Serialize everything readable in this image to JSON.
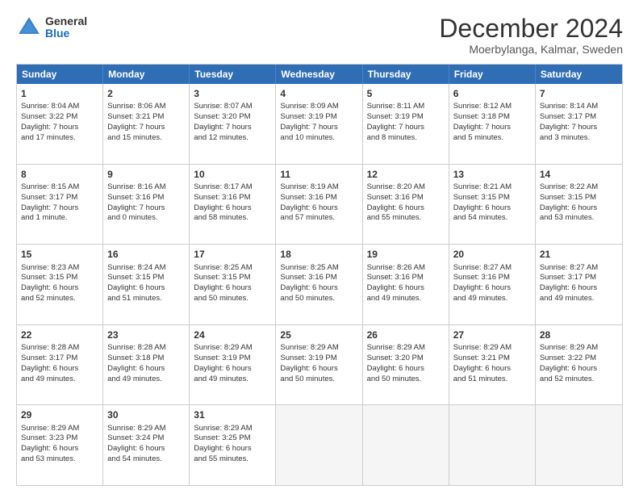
{
  "header": {
    "logo_general": "General",
    "logo_blue": "Blue",
    "month_title": "December 2024",
    "location": "Moerbylanga, Kalmar, Sweden"
  },
  "days_of_week": [
    "Sunday",
    "Monday",
    "Tuesday",
    "Wednesday",
    "Thursday",
    "Friday",
    "Saturday"
  ],
  "weeks": [
    [
      {
        "day": "1",
        "lines": [
          "Sunrise: 8:04 AM",
          "Sunset: 3:22 PM",
          "Daylight: 7 hours",
          "and 17 minutes."
        ]
      },
      {
        "day": "2",
        "lines": [
          "Sunrise: 8:06 AM",
          "Sunset: 3:21 PM",
          "Daylight: 7 hours",
          "and 15 minutes."
        ]
      },
      {
        "day": "3",
        "lines": [
          "Sunrise: 8:07 AM",
          "Sunset: 3:20 PM",
          "Daylight: 7 hours",
          "and 12 minutes."
        ]
      },
      {
        "day": "4",
        "lines": [
          "Sunrise: 8:09 AM",
          "Sunset: 3:19 PM",
          "Daylight: 7 hours",
          "and 10 minutes."
        ]
      },
      {
        "day": "5",
        "lines": [
          "Sunrise: 8:11 AM",
          "Sunset: 3:19 PM",
          "Daylight: 7 hours",
          "and 8 minutes."
        ]
      },
      {
        "day": "6",
        "lines": [
          "Sunrise: 8:12 AM",
          "Sunset: 3:18 PM",
          "Daylight: 7 hours",
          "and 5 minutes."
        ]
      },
      {
        "day": "7",
        "lines": [
          "Sunrise: 8:14 AM",
          "Sunset: 3:17 PM",
          "Daylight: 7 hours",
          "and 3 minutes."
        ]
      }
    ],
    [
      {
        "day": "8",
        "lines": [
          "Sunrise: 8:15 AM",
          "Sunset: 3:17 PM",
          "Daylight: 7 hours",
          "and 1 minute."
        ]
      },
      {
        "day": "9",
        "lines": [
          "Sunrise: 8:16 AM",
          "Sunset: 3:16 PM",
          "Daylight: 7 hours",
          "and 0 minutes."
        ]
      },
      {
        "day": "10",
        "lines": [
          "Sunrise: 8:17 AM",
          "Sunset: 3:16 PM",
          "Daylight: 6 hours",
          "and 58 minutes."
        ]
      },
      {
        "day": "11",
        "lines": [
          "Sunrise: 8:19 AM",
          "Sunset: 3:16 PM",
          "Daylight: 6 hours",
          "and 57 minutes."
        ]
      },
      {
        "day": "12",
        "lines": [
          "Sunrise: 8:20 AM",
          "Sunset: 3:16 PM",
          "Daylight: 6 hours",
          "and 55 minutes."
        ]
      },
      {
        "day": "13",
        "lines": [
          "Sunrise: 8:21 AM",
          "Sunset: 3:15 PM",
          "Daylight: 6 hours",
          "and 54 minutes."
        ]
      },
      {
        "day": "14",
        "lines": [
          "Sunrise: 8:22 AM",
          "Sunset: 3:15 PM",
          "Daylight: 6 hours",
          "and 53 minutes."
        ]
      }
    ],
    [
      {
        "day": "15",
        "lines": [
          "Sunrise: 8:23 AM",
          "Sunset: 3:15 PM",
          "Daylight: 6 hours",
          "and 52 minutes."
        ]
      },
      {
        "day": "16",
        "lines": [
          "Sunrise: 8:24 AM",
          "Sunset: 3:15 PM",
          "Daylight: 6 hours",
          "and 51 minutes."
        ]
      },
      {
        "day": "17",
        "lines": [
          "Sunrise: 8:25 AM",
          "Sunset: 3:15 PM",
          "Daylight: 6 hours",
          "and 50 minutes."
        ]
      },
      {
        "day": "18",
        "lines": [
          "Sunrise: 8:25 AM",
          "Sunset: 3:16 PM",
          "Daylight: 6 hours",
          "and 50 minutes."
        ]
      },
      {
        "day": "19",
        "lines": [
          "Sunrise: 8:26 AM",
          "Sunset: 3:16 PM",
          "Daylight: 6 hours",
          "and 49 minutes."
        ]
      },
      {
        "day": "20",
        "lines": [
          "Sunrise: 8:27 AM",
          "Sunset: 3:16 PM",
          "Daylight: 6 hours",
          "and 49 minutes."
        ]
      },
      {
        "day": "21",
        "lines": [
          "Sunrise: 8:27 AM",
          "Sunset: 3:17 PM",
          "Daylight: 6 hours",
          "and 49 minutes."
        ]
      }
    ],
    [
      {
        "day": "22",
        "lines": [
          "Sunrise: 8:28 AM",
          "Sunset: 3:17 PM",
          "Daylight: 6 hours",
          "and 49 minutes."
        ]
      },
      {
        "day": "23",
        "lines": [
          "Sunrise: 8:28 AM",
          "Sunset: 3:18 PM",
          "Daylight: 6 hours",
          "and 49 minutes."
        ]
      },
      {
        "day": "24",
        "lines": [
          "Sunrise: 8:29 AM",
          "Sunset: 3:19 PM",
          "Daylight: 6 hours",
          "and 49 minutes."
        ]
      },
      {
        "day": "25",
        "lines": [
          "Sunrise: 8:29 AM",
          "Sunset: 3:19 PM",
          "Daylight: 6 hours",
          "and 50 minutes."
        ]
      },
      {
        "day": "26",
        "lines": [
          "Sunrise: 8:29 AM",
          "Sunset: 3:20 PM",
          "Daylight: 6 hours",
          "and 50 minutes."
        ]
      },
      {
        "day": "27",
        "lines": [
          "Sunrise: 8:29 AM",
          "Sunset: 3:21 PM",
          "Daylight: 6 hours",
          "and 51 minutes."
        ]
      },
      {
        "day": "28",
        "lines": [
          "Sunrise: 8:29 AM",
          "Sunset: 3:22 PM",
          "Daylight: 6 hours",
          "and 52 minutes."
        ]
      }
    ],
    [
      {
        "day": "29",
        "lines": [
          "Sunrise: 8:29 AM",
          "Sunset: 3:23 PM",
          "Daylight: 6 hours",
          "and 53 minutes."
        ]
      },
      {
        "day": "30",
        "lines": [
          "Sunrise: 8:29 AM",
          "Sunset: 3:24 PM",
          "Daylight: 6 hours",
          "and 54 minutes."
        ]
      },
      {
        "day": "31",
        "lines": [
          "Sunrise: 8:29 AM",
          "Sunset: 3:25 PM",
          "Daylight: 6 hours",
          "and 55 minutes."
        ]
      },
      {
        "day": "",
        "lines": []
      },
      {
        "day": "",
        "lines": []
      },
      {
        "day": "",
        "lines": []
      },
      {
        "day": "",
        "lines": []
      }
    ]
  ]
}
